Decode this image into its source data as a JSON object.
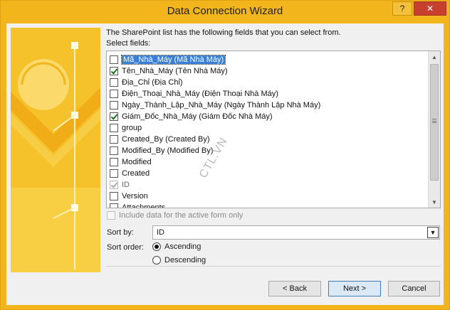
{
  "window": {
    "title": "Data Connection Wizard",
    "help_label": "?",
    "close_label": "✕"
  },
  "intro": "The SharePoint list has the following fields that you can select from.",
  "select_fields_label": "Select fields:",
  "fields": [
    {
      "label": "Mã_Nhà_Máy (Mã Nhà Máy)",
      "checked": false,
      "selected": true,
      "disabled": false
    },
    {
      "label": "Tên_Nhà_Máy (Tên Nhà Máy)",
      "checked": true,
      "selected": false,
      "disabled": false
    },
    {
      "label": "Địa_Chỉ (Địa Chỉ)",
      "checked": false,
      "selected": false,
      "disabled": false
    },
    {
      "label": "Điện_Thoại_Nhà_Máy (Điện Thoại Nhà Máy)",
      "checked": false,
      "selected": false,
      "disabled": false
    },
    {
      "label": "Ngày_Thành_Lập_Nhà_Máy (Ngày Thành Lập Nhà Máy)",
      "checked": false,
      "selected": false,
      "disabled": false
    },
    {
      "label": "Giám_Đốc_Nhà_Máy (Giám Đốc Nhà Máy)",
      "checked": true,
      "selected": false,
      "disabled": false
    },
    {
      "label": "group",
      "checked": false,
      "selected": false,
      "disabled": false
    },
    {
      "label": "Created_By (Created By)",
      "checked": false,
      "selected": false,
      "disabled": false
    },
    {
      "label": "Modified_By (Modified By)",
      "checked": false,
      "selected": false,
      "disabled": false
    },
    {
      "label": "Modified",
      "checked": false,
      "selected": false,
      "disabled": false
    },
    {
      "label": "Created",
      "checked": false,
      "selected": false,
      "disabled": false
    },
    {
      "label": "ID",
      "checked": true,
      "selected": false,
      "disabled": true
    },
    {
      "label": "Version",
      "checked": false,
      "selected": false,
      "disabled": false
    },
    {
      "label": "Attachments",
      "checked": false,
      "selected": false,
      "disabled": false
    }
  ],
  "include_label": "Include data for the active form only",
  "sort_by_label": "Sort by:",
  "sort_by_value": "ID",
  "sort_order_label": "Sort order:",
  "ascending_label": "Ascending",
  "descending_label": "Descending",
  "sort_order_value": "Ascending",
  "buttons": {
    "back": "< Back",
    "next": "Next >",
    "cancel": "Cancel"
  },
  "watermark": "CTL.VN"
}
